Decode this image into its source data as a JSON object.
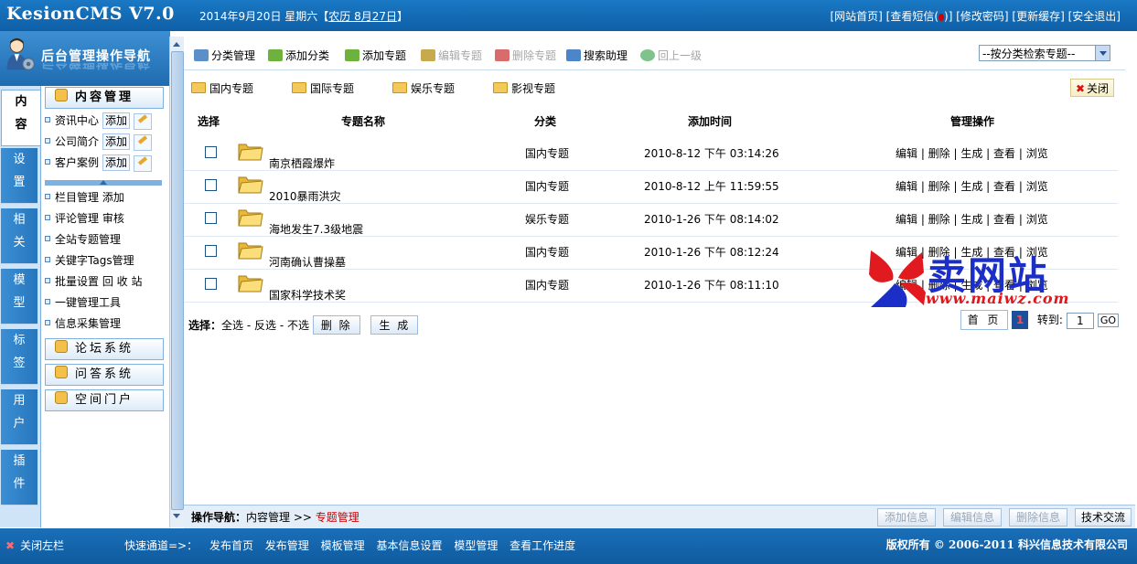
{
  "header": {
    "logo": "KesionCMS V7.0",
    "date": "2014年9月20日  星期六【",
    "lunar": "农历 8月27日",
    "date_end": "】",
    "links": [
      "[网站首页]",
      "[查看短信(",
      ")]",
      "[修改密码]",
      "[更新缓存]",
      "[安全退出]"
    ],
    "unread_dot_color": "#cc0000"
  },
  "nav": {
    "title": "后台管理操作导航",
    "tabs": [
      {
        "top": "内",
        "bottom": "容"
      },
      {
        "top": "设",
        "bottom": "置"
      },
      {
        "top": "相",
        "bottom": "关"
      },
      {
        "top": "模",
        "bottom": "型"
      },
      {
        "top": "标",
        "bottom": "签"
      },
      {
        "top": "用",
        "bottom": "户"
      },
      {
        "top": "插",
        "bottom": "件"
      }
    ],
    "section_content": "内容管理",
    "items_with_add": [
      {
        "label": "资讯中心",
        "add": "添加"
      },
      {
        "label": "公司简介",
        "add": "添加"
      },
      {
        "label": "客户案例",
        "add": "添加"
      }
    ],
    "items": [
      "栏目管理  添加",
      "评论管理  审核",
      "全站专题管理",
      "关键字Tags管理",
      "批量设置  回 收 站",
      "一键管理工具",
      "信息采集管理"
    ],
    "sections": [
      "论坛系统",
      "问答系统",
      "空间门户"
    ]
  },
  "toolbar": {
    "items": [
      {
        "label": "分类管理",
        "enabled": true,
        "color": "#5a8fc8"
      },
      {
        "label": "添加分类",
        "enabled": true,
        "color": "#6cb23c"
      },
      {
        "label": "添加专题",
        "enabled": true,
        "color": "#6cb23c"
      },
      {
        "label": "编辑专题",
        "enabled": false,
        "color": "#c9a94e"
      },
      {
        "label": "删除专题",
        "enabled": false,
        "color": "#d86b6b"
      },
      {
        "label": "搜索助理",
        "enabled": true,
        "color": "#4c86c9"
      },
      {
        "label": "回上一级",
        "enabled": false,
        "color": "#7fc28a"
      }
    ],
    "search_select": "--按分类检索专题--"
  },
  "categories": [
    "国内专题",
    "国际专题",
    "娱乐专题",
    "影视专题"
  ],
  "close_label": "关闭",
  "table": {
    "headers": [
      "选择",
      "专题名称",
      "分类",
      "添加时间",
      "管理操作"
    ],
    "rows": [
      {
        "name": "南京栖霞爆炸",
        "category": "国内专题",
        "time": "2010-8-12 下午 03:14:26",
        "ops": "编辑 | 删除 | 生成 | 查看 | 浏览"
      },
      {
        "name": "2010暴雨洪灾",
        "category": "国内专题",
        "time": "2010-8-12 上午 11:59:55",
        "ops": "编辑 | 删除 | 生成 | 查看 | 浏览"
      },
      {
        "name": "海地发生7.3级地震",
        "category": "娱乐专题",
        "time": "2010-1-26 下午 08:14:02",
        "ops": "编辑 | 删除 | 生成 | 查看 | 浏览"
      },
      {
        "name": "河南确认曹操墓",
        "category": "国内专题",
        "time": "2010-1-26 下午 08:12:24",
        "ops": "编辑 | 删除 | 生成 | 查看 | 浏览"
      },
      {
        "name": "国家科学技术奖",
        "category": "国内专题",
        "time": "2010-1-26 下午 08:11:10",
        "ops": "编辑 | 删除 | 生成 | 查看 | 浏览"
      }
    ]
  },
  "selection": {
    "label": "选择：",
    "all": "全选",
    "invert": "反选",
    "none": "不选",
    "delete": "删 除",
    "generate": "生 成"
  },
  "pager": {
    "first": "首 页",
    "current": "1",
    "goto_label": "转到:",
    "goto_value": "1",
    "go": "GO"
  },
  "watermark": {
    "text": "卖网站",
    "url": "www.maiwz.com"
  },
  "status": {
    "breadcrumb_label": "操作导航：",
    "path1": "内容管理",
    "sep": ">>",
    "path2": "专题管理",
    "buttons": [
      {
        "label": "添加信息",
        "enabled": false
      },
      {
        "label": "编辑信息",
        "enabled": false
      },
      {
        "label": "删除信息",
        "enabled": false
      },
      {
        "label": "技术交流",
        "enabled": true
      }
    ]
  },
  "footer": {
    "close_left": "关闭左栏",
    "quick_label": "快速通道=>：",
    "quick_links": [
      "发布首页",
      "发布管理",
      "模板管理",
      "基本信息设置",
      "模型管理",
      "查看工作进度"
    ],
    "copyright": "版权所有 © 2006-2011 科兴信息技术有限公司"
  }
}
